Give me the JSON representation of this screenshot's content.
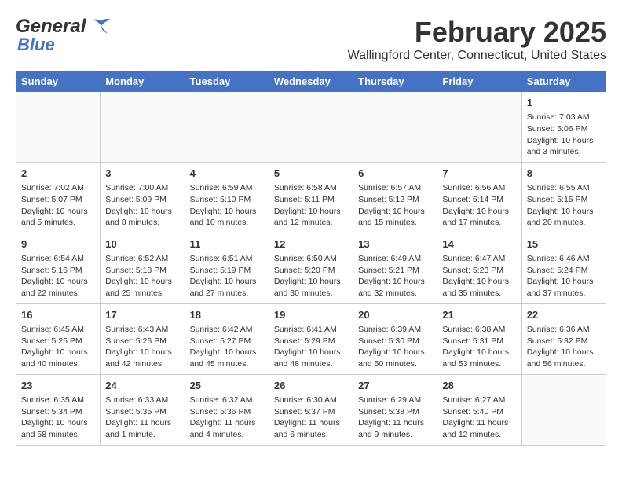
{
  "header": {
    "logo_line1": "General",
    "logo_line2": "Blue",
    "month": "February 2025",
    "location": "Wallingford Center, Connecticut, United States"
  },
  "weekdays": [
    "Sunday",
    "Monday",
    "Tuesday",
    "Wednesday",
    "Thursday",
    "Friday",
    "Saturday"
  ],
  "weeks": [
    [
      {
        "day": "",
        "detail": ""
      },
      {
        "day": "",
        "detail": ""
      },
      {
        "day": "",
        "detail": ""
      },
      {
        "day": "",
        "detail": ""
      },
      {
        "day": "",
        "detail": ""
      },
      {
        "day": "",
        "detail": ""
      },
      {
        "day": "1",
        "detail": "Sunrise: 7:03 AM\nSunset: 5:06 PM\nDaylight: 10 hours\nand 3 minutes."
      }
    ],
    [
      {
        "day": "2",
        "detail": "Sunrise: 7:02 AM\nSunset: 5:07 PM\nDaylight: 10 hours\nand 5 minutes."
      },
      {
        "day": "3",
        "detail": "Sunrise: 7:00 AM\nSunset: 5:09 PM\nDaylight: 10 hours\nand 8 minutes."
      },
      {
        "day": "4",
        "detail": "Sunrise: 6:59 AM\nSunset: 5:10 PM\nDaylight: 10 hours\nand 10 minutes."
      },
      {
        "day": "5",
        "detail": "Sunrise: 6:58 AM\nSunset: 5:11 PM\nDaylight: 10 hours\nand 12 minutes."
      },
      {
        "day": "6",
        "detail": "Sunrise: 6:57 AM\nSunset: 5:12 PM\nDaylight: 10 hours\nand 15 minutes."
      },
      {
        "day": "7",
        "detail": "Sunrise: 6:56 AM\nSunset: 5:14 PM\nDaylight: 10 hours\nand 17 minutes."
      },
      {
        "day": "8",
        "detail": "Sunrise: 6:55 AM\nSunset: 5:15 PM\nDaylight: 10 hours\nand 20 minutes."
      }
    ],
    [
      {
        "day": "9",
        "detail": "Sunrise: 6:54 AM\nSunset: 5:16 PM\nDaylight: 10 hours\nand 22 minutes."
      },
      {
        "day": "10",
        "detail": "Sunrise: 6:52 AM\nSunset: 5:18 PM\nDaylight: 10 hours\nand 25 minutes."
      },
      {
        "day": "11",
        "detail": "Sunrise: 6:51 AM\nSunset: 5:19 PM\nDaylight: 10 hours\nand 27 minutes."
      },
      {
        "day": "12",
        "detail": "Sunrise: 6:50 AM\nSunset: 5:20 PM\nDaylight: 10 hours\nand 30 minutes."
      },
      {
        "day": "13",
        "detail": "Sunrise: 6:49 AM\nSunset: 5:21 PM\nDaylight: 10 hours\nand 32 minutes."
      },
      {
        "day": "14",
        "detail": "Sunrise: 6:47 AM\nSunset: 5:23 PM\nDaylight: 10 hours\nand 35 minutes."
      },
      {
        "day": "15",
        "detail": "Sunrise: 6:46 AM\nSunset: 5:24 PM\nDaylight: 10 hours\nand 37 minutes."
      }
    ],
    [
      {
        "day": "16",
        "detail": "Sunrise: 6:45 AM\nSunset: 5:25 PM\nDaylight: 10 hours\nand 40 minutes."
      },
      {
        "day": "17",
        "detail": "Sunrise: 6:43 AM\nSunset: 5:26 PM\nDaylight: 10 hours\nand 42 minutes."
      },
      {
        "day": "18",
        "detail": "Sunrise: 6:42 AM\nSunset: 5:27 PM\nDaylight: 10 hours\nand 45 minutes."
      },
      {
        "day": "19",
        "detail": "Sunrise: 6:41 AM\nSunset: 5:29 PM\nDaylight: 10 hours\nand 48 minutes."
      },
      {
        "day": "20",
        "detail": "Sunrise: 6:39 AM\nSunset: 5:30 PM\nDaylight: 10 hours\nand 50 minutes."
      },
      {
        "day": "21",
        "detail": "Sunrise: 6:38 AM\nSunset: 5:31 PM\nDaylight: 10 hours\nand 53 minutes."
      },
      {
        "day": "22",
        "detail": "Sunrise: 6:36 AM\nSunset: 5:32 PM\nDaylight: 10 hours\nand 56 minutes."
      }
    ],
    [
      {
        "day": "23",
        "detail": "Sunrise: 6:35 AM\nSunset: 5:34 PM\nDaylight: 10 hours\nand 58 minutes."
      },
      {
        "day": "24",
        "detail": "Sunrise: 6:33 AM\nSunset: 5:35 PM\nDaylight: 11 hours\nand 1 minute."
      },
      {
        "day": "25",
        "detail": "Sunrise: 6:32 AM\nSunset: 5:36 PM\nDaylight: 11 hours\nand 4 minutes."
      },
      {
        "day": "26",
        "detail": "Sunrise: 6:30 AM\nSunset: 5:37 PM\nDaylight: 11 hours\nand 6 minutes."
      },
      {
        "day": "27",
        "detail": "Sunrise: 6:29 AM\nSunset: 5:38 PM\nDaylight: 11 hours\nand 9 minutes."
      },
      {
        "day": "28",
        "detail": "Sunrise: 6:27 AM\nSunset: 5:40 PM\nDaylight: 11 hours\nand 12 minutes."
      },
      {
        "day": "",
        "detail": ""
      }
    ]
  ]
}
